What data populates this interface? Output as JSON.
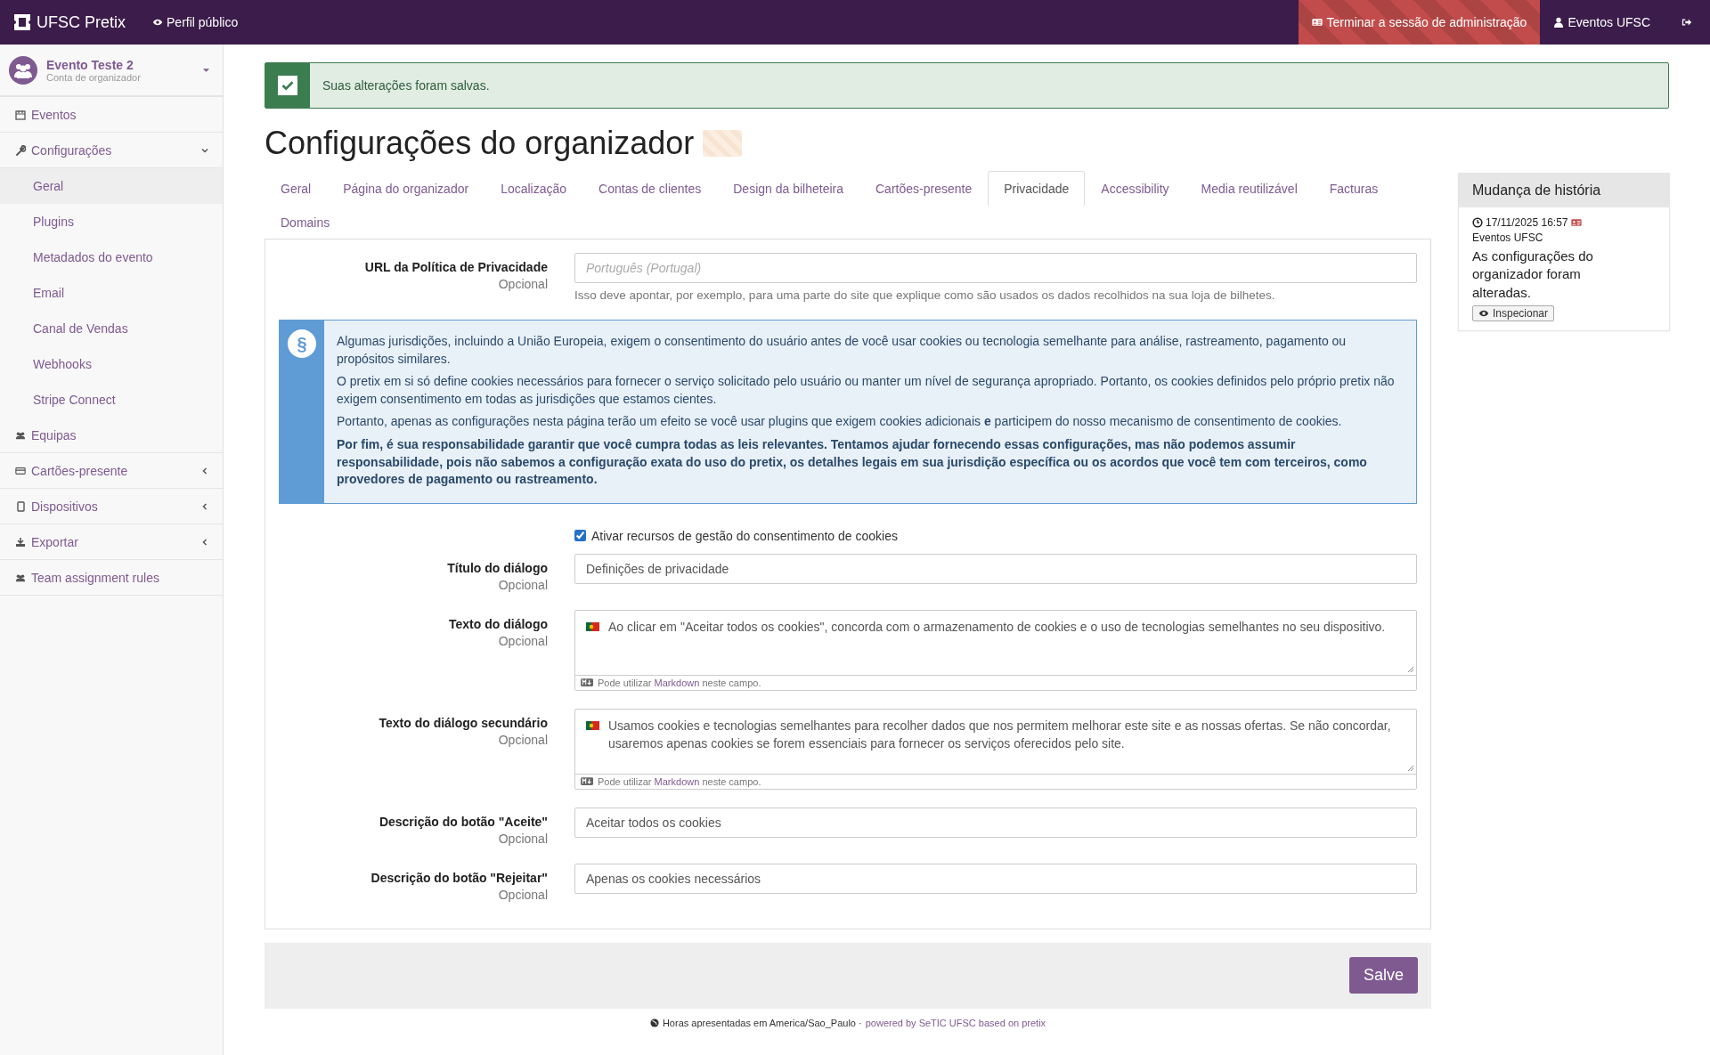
{
  "topbar": {
    "brand": "UFSC Pretix",
    "public_profile": "Perfil público",
    "end_admin": "Terminar a sessão de administração",
    "user": "Eventos UFSC"
  },
  "organizer": {
    "name": "Evento Teste 2",
    "subtitle": "Conta de organizador"
  },
  "sidebar": {
    "items": [
      {
        "label": "Eventos"
      },
      {
        "label": "Configurações",
        "expanded": true,
        "children": [
          {
            "label": "Geral",
            "selected": true
          },
          {
            "label": "Plugins",
            "selected": false
          },
          {
            "label": "Metadados do evento",
            "selected": false
          },
          {
            "label": "Email",
            "selected": false
          },
          {
            "label": "Canal de Vendas",
            "selected": false
          },
          {
            "label": "Webhooks",
            "selected": false
          },
          {
            "label": "Stripe Connect",
            "selected": false
          }
        ]
      },
      {
        "label": "Equipas"
      },
      {
        "label": "Cartões-presente",
        "expanded": false
      },
      {
        "label": "Dispositivos",
        "expanded": false
      },
      {
        "label": "Exportar",
        "expanded": false
      },
      {
        "label": "Team assignment rules"
      }
    ]
  },
  "alert": {
    "message": "Suas alterações foram salvas."
  },
  "page_title": "Configurações do organizador",
  "tabs": [
    {
      "label": "Geral",
      "selected": false
    },
    {
      "label": "Página do organizador",
      "selected": false
    },
    {
      "label": "Localização",
      "selected": false
    },
    {
      "label": "Contas de clientes",
      "selected": false
    },
    {
      "label": "Design da bilheteira",
      "selected": false
    },
    {
      "label": "Cartões-presente",
      "selected": false
    },
    {
      "label": "Privacidade",
      "selected": true
    },
    {
      "label": "Accessibility",
      "selected": false
    },
    {
      "label": "Media reutilizável",
      "selected": false
    },
    {
      "label": "Facturas",
      "selected": false
    },
    {
      "label": "Domains",
      "selected": false
    }
  ],
  "privacy_url": {
    "label": "URL da Política de Privacidade",
    "optional": "Opcional",
    "placeholder": "Português (Portugal)",
    "help": "Isso deve apontar, por exemplo, para uma parte do site que explique como são usados os dados recolhidos na sua loja de bilhetes."
  },
  "info_box": {
    "icon": "§",
    "paragraphs": [
      {
        "text": "Algumas jurisdições, incluindo a União Europeia, exigem o consentimento do usuário antes de você usar cookies ou tecnologia semelhante para análise, rastreamento, pagamento ou propósitos similares.",
        "bold": false
      },
      {
        "text": "O pretix em si só define cookies necessários para fornecer o serviço solicitado pelo usuário ou manter um nível de segurança apropriado. Portanto, os cookies definidos pelo próprio pretix não exigem consentimento em todas as jurisdições que estamos cientes.",
        "bold": false
      },
      {
        "text": "Portanto, apenas as configurações nesta página terão um efeito se você usar plugins que exigem cookies adicionais **e** participem do nosso mecanismo de consentimento de cookies.",
        "bold": false
      },
      {
        "text": "Por fim, é sua responsabilidade garantir que você cumpra todas as leis relevantes. Tentamos ajudar fornecendo essas configurações, mas não podemos assumir responsabilidade, pois não sabemos a configuração exata do uso do pretix, os detalhes legais em sua jurisdição específica ou os acordos que você tem com terceiros, como provedores de pagamento ou rastreamento.",
        "bold": true
      }
    ]
  },
  "consent_checkbox": {
    "label": "Ativar recursos de gestão do consentimento de cookies",
    "checked": true
  },
  "fields": [
    {
      "kind": "text",
      "label": "Título do diálogo",
      "optional": "Opcional",
      "value": "Definições de privacidade"
    },
    {
      "kind": "textarea",
      "label": "Texto do diálogo",
      "optional": "Opcional",
      "value": "Ao clicar em \"Aceitar todos os cookies\", concorda com o armazenamento de cookies e o uso de tecnologias semelhantes no seu dispositivo.",
      "hint_before": "Pode utilizar",
      "hint_link": "Markdown",
      "hint_after": "neste campo."
    },
    {
      "kind": "textarea",
      "label": "Texto do diálogo secundário",
      "optional": "Opcional",
      "value": "Usamos cookies e tecnologias semelhantes para recolher dados que nos permitem melhorar este site e as nossas ofertas. Se não concordar, usaremos apenas cookies se forem essenciais para fornecer os serviços oferecidos pelo site.",
      "hint_before": "Pode utilizar",
      "hint_link": "Markdown",
      "hint_after": "neste campo."
    },
    {
      "kind": "text",
      "label": "Descrição do botão \"Aceite\"",
      "optional": "Opcional",
      "value": "Aceitar todos os cookies"
    },
    {
      "kind": "text",
      "label": "Descrição do botão \"Rejeitar\"",
      "optional": "Opcional",
      "value": "Apenas os cookies necessários"
    }
  ],
  "save_button": "Salve",
  "history": {
    "title": "Mudança de história",
    "entries": [
      {
        "time": "17/11/2025 16:57",
        "user": "Eventos UFSC",
        "text": "As configurações do organizador foram alteradas.",
        "button": "Inspecionar"
      }
    ]
  },
  "footer": {
    "text": "Horas apresentadas em America/Sao_Paulo ·",
    "link": "powered by SeTIC UFSC based on pretix"
  }
}
